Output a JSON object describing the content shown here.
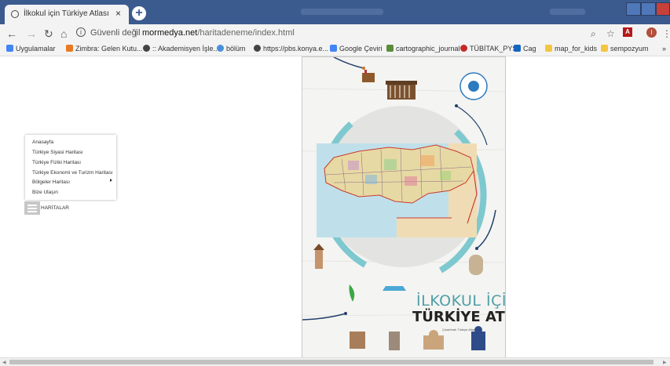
{
  "browser": {
    "tab_title": "İlkokul için Türkiye Atlası",
    "tab_close": "×",
    "new_tab": "+",
    "security_label": "Güvenli değil",
    "url_host": "mormedya.net",
    "url_path": "/haritadeneme/index.html",
    "pdf_label": "A",
    "profile_initial": "I"
  },
  "bookmarks": [
    {
      "label": "Uygulamalar",
      "color": "#4285f4"
    },
    {
      "label": "Zimbra: Gelen Kutu...",
      "color": "#e87a25"
    },
    {
      "label": ":: Akademisyen İşle...",
      "color": "#444444"
    },
    {
      "label": "bölüm",
      "color": "#4a90d9"
    },
    {
      "label": "https://pbs.konya.e...",
      "color": "#444444"
    },
    {
      "label": "Google Çeviri",
      "color": "#4285f4"
    },
    {
      "label": "cartographic_journal",
      "color": "#5b8c3a"
    },
    {
      "label": "TÜBİTAK_PYS",
      "color": "#c62828"
    },
    {
      "label": "Cag",
      "color": "#1565c0"
    },
    {
      "label": "map_for_kids",
      "color": "#f4c542"
    },
    {
      "label": "sempozyum",
      "color": "#f4c542"
    }
  ],
  "bookmarks_more": "»",
  "menu": {
    "items": [
      "Anasayfa",
      "Türkiye Siyasi Haritası",
      "Türkiye Fiziki Haritası",
      "Türkiye Ekonomi ve Turizm Haritası",
      "Bölgeler Haritası",
      "Bize Ulaşın"
    ],
    "hamburger_label": "HARİTALAR"
  },
  "cover": {
    "title_line1": "İLKOKUL İÇİN",
    "title_line2": "TÜRKİYE ATLASI",
    "subtitle": "Çıkartmalı Türkiye Atlası"
  },
  "colors": {
    "titlebar": "#3b5b8f",
    "teal_arc": "#7ec8cf",
    "navy_line": "#23406b",
    "map_sea": "#bfe0ea"
  }
}
